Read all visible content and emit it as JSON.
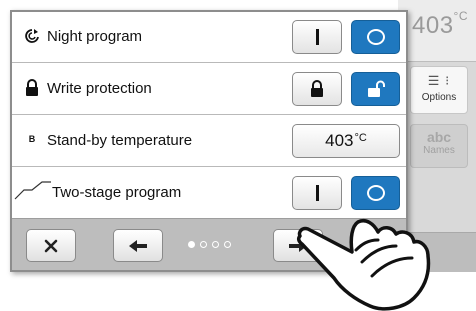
{
  "background": {
    "temperature_partial": "403",
    "temperature_unit": "°C",
    "options_label": "Options",
    "names_icon_text": "abc",
    "names_label": "Names"
  },
  "settings": {
    "rows": [
      {
        "label": "Night program",
        "icon": "night-program-icon",
        "on_selected": true
      },
      {
        "label": "Write protection",
        "icon": "lock-icon",
        "unlocked_selected": true
      },
      {
        "label": "Stand-by temperature",
        "icon_text": "B",
        "value": "403",
        "unit": "°C"
      },
      {
        "label": "Two-stage program",
        "icon": "two-stage-curve-icon",
        "on_selected": true
      }
    ]
  },
  "toolbar": {
    "page_count": 4,
    "current_page": 1,
    "buttons": [
      "close-icon",
      "arrow-left-icon",
      "arrow-right-icon"
    ]
  },
  "colors": {
    "accent": "#1f78bf",
    "toolbar": "#bdbdbd",
    "divider": "#b9b9b9"
  },
  "overlay": {
    "icon": "pointing-hand-icon"
  }
}
